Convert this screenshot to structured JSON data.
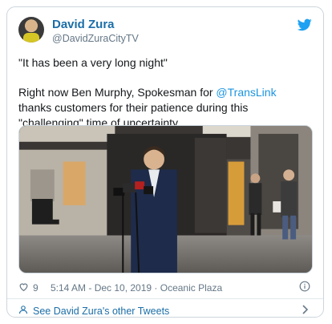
{
  "author": {
    "name": "David Zura",
    "handle": "@DavidZuraCityTV"
  },
  "tweet": {
    "quote": "\"It has been a very long night\"",
    "body_before": "Right now Ben Murphy, Spokesman for ",
    "mention": "@TransLink",
    "body_after": " thanks customers for their patience during this \"challenging\" time of uncertainty."
  },
  "meta": {
    "likes": "9",
    "timestamp": "5:14 AM - Dec 10, 2019 · Oceanic Plaza"
  },
  "footer": {
    "link_text": "See David Zura's other Tweets"
  },
  "icons": {
    "brand": "twitter-bird-icon",
    "like": "heart-icon",
    "info": "info-icon",
    "profile": "person-icon",
    "next": "chevron-right-icon"
  },
  "colors": {
    "link_blue": "#1b95e0",
    "name_blue": "#1b6ea8",
    "meta_gray": "#657786",
    "border": "#ccd6dd"
  }
}
